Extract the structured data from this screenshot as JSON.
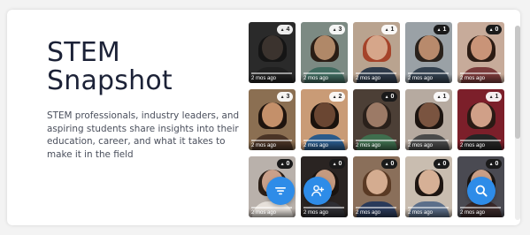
{
  "header": {
    "title_line1": "STEM",
    "title_line2": "Snapshot",
    "description": "STEM professionals, industry leaders, and aspiring students share insights into their education, career, and what it takes to make it in the field"
  },
  "colors": {
    "accent": "#2e8ce8",
    "title": "#1c2237",
    "body_text": "#4a4f5c"
  },
  "videos": [
    {
      "count": "4",
      "age": "2 mos ago",
      "badge_style": "light",
      "bg": "#2a2a2a",
      "skin": "#3b332e",
      "hair": "#151515",
      "shirt": "#202020"
    },
    {
      "count": "3",
      "age": "2 mos ago",
      "badge_style": "light",
      "bg": "#7c8a83",
      "skin": "#b08868",
      "hair": "#2a1d15",
      "shirt": "#3f6a5f"
    },
    {
      "count": "1",
      "age": "2 mos ago",
      "badge_style": "light",
      "bg": "#b9a38f",
      "skin": "#d6a68a",
      "hair": "#a5432a",
      "shirt": "#2e3a4a"
    },
    {
      "count": "1",
      "age": "2 mos ago",
      "badge_style": "dark",
      "bg": "#9aa1a6",
      "skin": "#b88a6c",
      "hair": "#2a221c",
      "shirt": "#33414f"
    },
    {
      "count": "0",
      "age": "2 mos ago",
      "badge_style": "dark",
      "bg": "#c7ab9a",
      "skin": "#c99478",
      "hair": "#2c1c14",
      "shirt": "#7a3a3a"
    },
    {
      "count": "3",
      "age": "2 mos ago",
      "badge_style": "light",
      "bg": "#8b6f52",
      "skin": "#c4906a",
      "hair": "#1f140e",
      "shirt": "#4a3426"
    },
    {
      "count": "2",
      "age": "2 mos ago",
      "badge_style": "light",
      "bg": "#c99b76",
      "skin": "#6a4632",
      "hair": "#1a120d",
      "shirt": "#2a5a8a"
    },
    {
      "count": "0",
      "age": "2 mos ago",
      "badge_style": "dark",
      "bg": "#4c3f36",
      "skin": "#9c7a66",
      "hair": "#2a201a",
      "shirt": "#3f6e4e"
    },
    {
      "count": "1",
      "age": "2 mos ago",
      "badge_style": "light",
      "bg": "#b6aaa0",
      "skin": "#7a5440",
      "hair": "#1c1410",
      "shirt": "#4a4a4a"
    },
    {
      "count": "1",
      "age": "2 mos ago",
      "badge_style": "light",
      "bg": "#7c1f2a",
      "skin": "#d0a088",
      "hair": "#2a1a14",
      "shirt": "#252525"
    },
    {
      "count": "0",
      "age": "2 mos ago",
      "badge_style": "dark",
      "bg": "#b9b1ab",
      "skin": "#c9a08a",
      "hair": "#2a1e16",
      "shirt": "#e6e0da"
    },
    {
      "count": "0",
      "age": "2 mos ago",
      "badge_style": "dark",
      "bg": "#2a2422",
      "skin": "#c49a80",
      "hair": "#1a1410",
      "shirt": "#2f2f34"
    },
    {
      "count": "0",
      "age": "2 mos ago",
      "badge_style": "dark",
      "bg": "#8a6f5a",
      "skin": "#d4ac90",
      "hair": "#5a3a24",
      "shirt": "#2a3a5a"
    },
    {
      "count": "0",
      "age": "2 mos ago",
      "badge_style": "dark",
      "bg": "#c9bdb0",
      "skin": "#d6b096",
      "hair": "#1e1612",
      "shirt": "#5c6f8a"
    },
    {
      "count": "0",
      "age": "2 mos ago",
      "badge_style": "dark",
      "bg": "#4a4a52",
      "skin": "#c99e86",
      "hair": "#1c1612",
      "shirt": "#3a2a2a"
    }
  ],
  "fabs": [
    {
      "name": "filter-button",
      "icon": "filter-icon"
    },
    {
      "name": "add-user-button",
      "icon": "add-user-icon"
    },
    {
      "name": "search-button",
      "icon": "search-icon"
    }
  ]
}
